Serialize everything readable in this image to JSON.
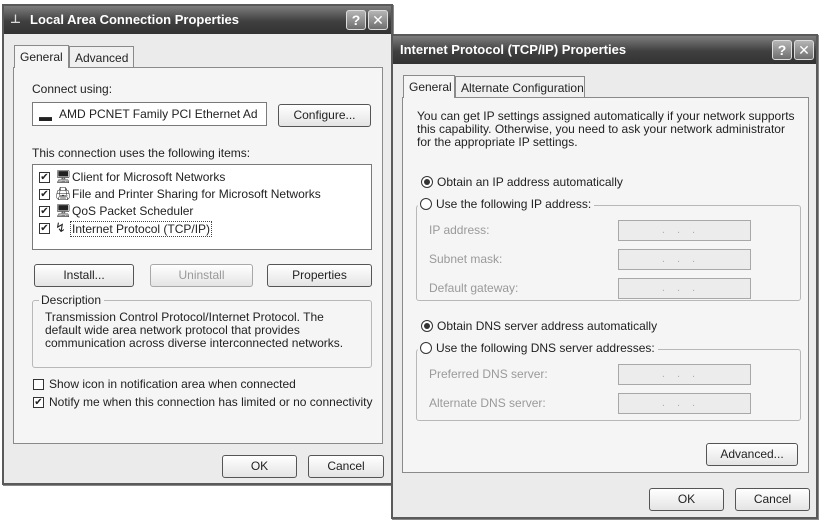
{
  "lan_dialog": {
    "title": "Local Area Connection Properties",
    "help_button": "?",
    "close_button": "✕",
    "tabs": [
      {
        "label": "General",
        "active": true
      },
      {
        "label": "Advanced",
        "active": false
      }
    ],
    "connect_using_label": "Connect using:",
    "adapter_name": "AMD PCNET Family PCI Ethernet Ad",
    "configure_button": "Configure...",
    "items_label": "This connection uses the following items:",
    "items": [
      {
        "label": "Client for Microsoft Networks",
        "checked": "✔",
        "icon": "🖥"
      },
      {
        "label": "File and Printer Sharing for Microsoft Networks",
        "checked": "✔",
        "icon": "🖨"
      },
      {
        "label": "QoS Packet Scheduler",
        "checked": "✔",
        "icon": "🖥"
      },
      {
        "label": "Internet Protocol (TCP/IP)",
        "checked": "✔",
        "icon": "↯"
      }
    ],
    "install_button": "Install...",
    "uninstall_button": "Uninstall",
    "properties_button": "Properties",
    "description_legend": "Description",
    "description_text": "Transmission Control Protocol/Internet Protocol. The default wide area network protocol that provides communication across diverse interconnected networks.",
    "show_icon_label": "Show icon in notification area when connected",
    "show_icon_checked": "",
    "notify_label": "Notify me when this connection has limited or no connectivity",
    "notify_checked": "✔",
    "ok_button": "OK",
    "cancel_button": "Cancel"
  },
  "tcpip_dialog": {
    "title": "Internet Protocol (TCP/IP) Properties",
    "help_button": "?",
    "close_button": "✕",
    "tabs": [
      {
        "label": "General",
        "active": true
      },
      {
        "label": "Alternate Configuration",
        "active": false
      }
    ],
    "intro_text": "You can get IP settings assigned automatically if your network supports this capability. Otherwise, you need to ask your network administrator for the appropriate IP settings.",
    "obtain_ip_auto": "Obtain an IP address automatically",
    "use_following_ip": "Use the following IP address:",
    "ip_address_label": "IP address:",
    "subnet_mask_label": "Subnet mask:",
    "default_gateway_label": "Default gateway:",
    "obtain_dns_auto": "Obtain DNS server address automatically",
    "use_following_dns": "Use the following DNS server addresses:",
    "preferred_dns_label": "Preferred DNS server:",
    "alternate_dns_label": "Alternate DNS server:",
    "ip_placeholder": "...",
    "advanced_button": "Advanced...",
    "ok_button": "OK",
    "cancel_button": "Cancel"
  }
}
